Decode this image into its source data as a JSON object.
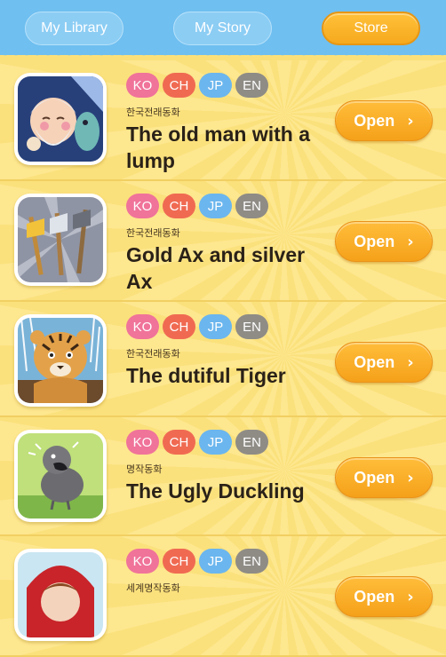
{
  "nav": {
    "tabs": [
      {
        "label": "My Library",
        "active": false
      },
      {
        "label": "My Story",
        "active": false
      },
      {
        "label": "Store",
        "active": true
      }
    ]
  },
  "colors": {
    "nav_bg": "#6fbff0",
    "accent_orange": "#f5a11a",
    "lang_ko": "#f0739a",
    "lang_ch": "#f06a52",
    "lang_jp": "#6bb6ee",
    "lang_en": "#8f8c86"
  },
  "languages": [
    "KO",
    "CH",
    "JP",
    "EN"
  ],
  "books": [
    {
      "category": "한국전래동화",
      "title": "The old man with a lump",
      "button": "Open",
      "icon": "old-man-cover"
    },
    {
      "category": "한국전래동화",
      "title": "Gold Ax and silver Ax",
      "button": "Open",
      "icon": "axes-cover"
    },
    {
      "category": "한국전래동화",
      "title": "The dutiful Tiger",
      "button": "Open",
      "icon": "tiger-cover"
    },
    {
      "category": "명작동화",
      "title": "The Ugly Duckling",
      "button": "Open",
      "icon": "duckling-cover"
    },
    {
      "category": "세계명작동화",
      "title": "",
      "button": "Open",
      "icon": "girl-cover"
    }
  ]
}
